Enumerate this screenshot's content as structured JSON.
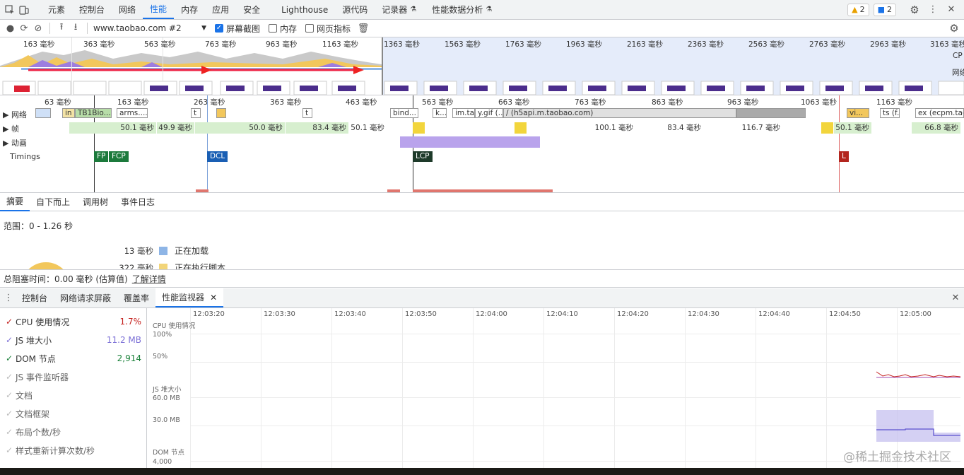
{
  "tabbar": {
    "tabs": [
      "元素",
      "控制台",
      "网络",
      "性能",
      "内存",
      "应用",
      "安全",
      "Lighthouse",
      "源代码",
      "记录器",
      "性能数据分析"
    ],
    "active": "性能",
    "warnings": "2",
    "messages": "2"
  },
  "toolbar": {
    "url": "www.taobao.com #2",
    "screenshots_label": "屏幕截图",
    "memory_label": "内存",
    "webvitals_label": "网页指标"
  },
  "overview": {
    "ticks": [
      "163 毫秒",
      "363 毫秒",
      "563 毫秒",
      "763 毫秒",
      "963 毫秒",
      "1163 毫秒",
      "1363 毫秒",
      "1563 毫秒",
      "1763 毫秒",
      "1963 毫秒",
      "2163 毫秒",
      "2363 毫秒",
      "2563 毫秒",
      "2763 毫秒",
      "2963 毫秒",
      "3163 毫秒"
    ],
    "side_labels": [
      "CP",
      "网络"
    ]
  },
  "timeline": {
    "ticks": [
      "63 毫秒",
      "163 毫秒",
      "263 毫秒",
      "363 毫秒",
      "463 毫秒",
      "563 毫秒",
      "663 毫秒",
      "763 毫秒",
      "863 毫秒",
      "963 毫秒",
      "1063 毫秒",
      "1163 毫秒"
    ],
    "tracks": {
      "network": "网络",
      "frames": "帧",
      "animation": "动画",
      "timings": "Timings"
    },
    "network_items": [
      "in",
      "TB1Bio...",
      "arms....",
      "t",
      "t",
      "bind...",
      "k...",
      "im.tao",
      "y.gif (...",
      "/ (h5api.m.taobao.com)",
      "vi...",
      "ts (f...",
      "ex (ecpm.tao"
    ],
    "frames": [
      "50.1 毫秒",
      "49.9 毫秒",
      "50.0 毫秒",
      "83.4 毫秒",
      "50.1 毫秒",
      "100.1 毫秒",
      "83.4 毫秒",
      "116.7 毫秒",
      "50.1 毫秒",
      "66.8 毫秒"
    ],
    "markers": [
      "FP",
      "FCP",
      "DCL",
      "LCP",
      "L"
    ]
  },
  "summary": {
    "tabs": [
      "摘要",
      "自下而上",
      "调用树",
      "事件日志"
    ],
    "active": "摘要",
    "range": "范围：0 - 1.26 秒",
    "legend": [
      {
        "value": "13 毫秒",
        "label": "正在加载",
        "color": "#8eb5e6"
      },
      {
        "value": "322 毫秒",
        "label": "正在执行脚本",
        "color": "#f2d57a"
      }
    ]
  },
  "blocking": {
    "text": "总阻塞时间：0.00 毫秒 (估算值)",
    "link": "了解详情"
  },
  "drawer": {
    "tabs": [
      "控制台",
      "网络请求屏蔽",
      "覆盖率",
      "性能监视器"
    ],
    "active": "性能监视器"
  },
  "monitor": {
    "metrics": [
      {
        "name": "CPU 使用情况",
        "value": "1.7%",
        "color": "#c5221f",
        "checked": true
      },
      {
        "name": "JS 堆大小",
        "value": "11.2 MB",
        "color": "#7b6fd6",
        "checked": true
      },
      {
        "name": "DOM 节点",
        "value": "2,914",
        "color": "#188038",
        "checked": true
      },
      {
        "name": "JS 事件监听器",
        "value": "",
        "color": "#888",
        "checked": false
      },
      {
        "name": "文档",
        "value": "",
        "color": "#888",
        "checked": false
      },
      {
        "name": "文档框架",
        "value": "",
        "color": "#888",
        "checked": false
      },
      {
        "name": "布局个数/秒",
        "value": "",
        "color": "#888",
        "checked": false
      },
      {
        "name": "样式重新计算次数/秒",
        "value": "",
        "color": "#888",
        "checked": false
      }
    ],
    "times": [
      "12:03:20",
      "12:03:30",
      "12:03:40",
      "12:03:50",
      "12:04:00",
      "12:04:10",
      "12:04:20",
      "12:04:30",
      "12:04:40",
      "12:04:50",
      "12:05:00"
    ],
    "axis": {
      "cpu_title": "CPU 使用情况",
      "cpu_100": "100%",
      "cpu_50": "50%",
      "heap_title": "JS 堆大小",
      "heap_60": "60.0 MB",
      "heap_30": "30.0 MB",
      "dom_title": "DOM 节点",
      "dom_4000": "4,000"
    }
  },
  "watermark": "@稀土掘金技术社区"
}
